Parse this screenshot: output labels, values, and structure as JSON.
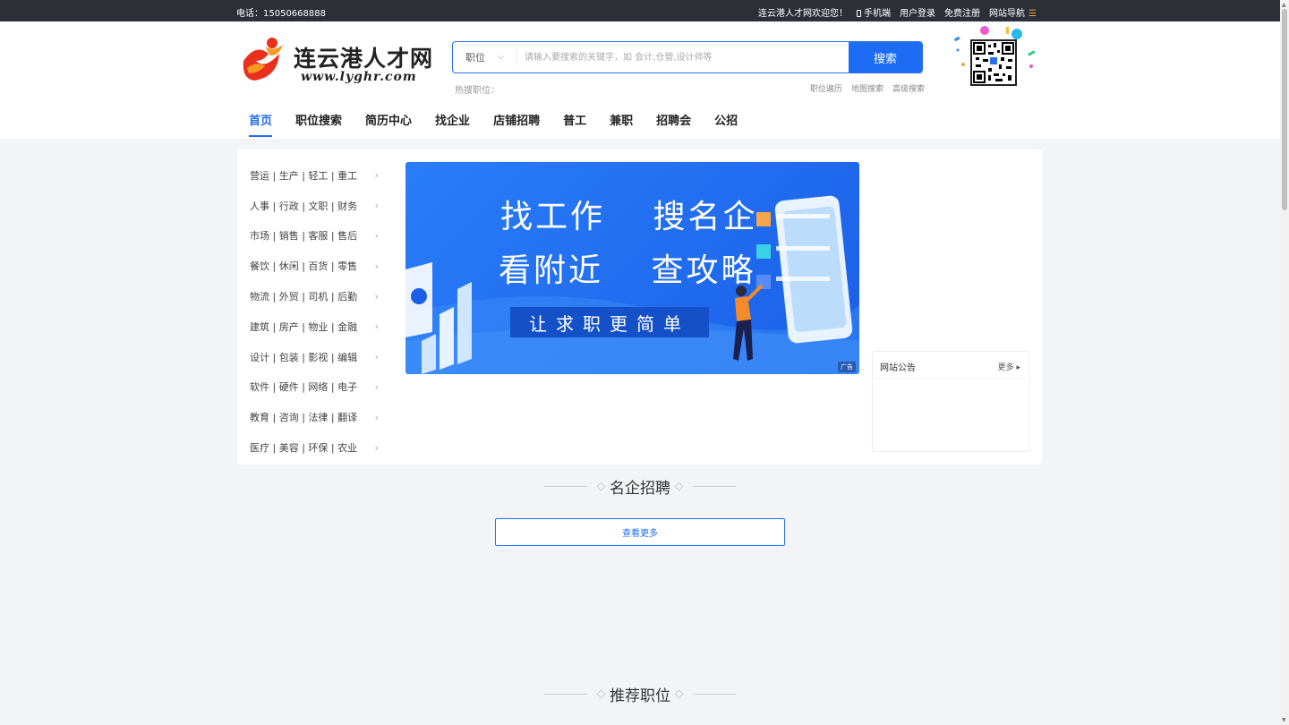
{
  "topbar": {
    "phone": "电话：15050668888",
    "welcome": "连云港人才网欢迎您！",
    "mobile": "手机端",
    "login": "用户登录",
    "register": "免费注册",
    "site_nav": "网站导航"
  },
  "logo": {
    "brand": "连云港人才网",
    "url": "www.lyghr.com"
  },
  "search": {
    "type": "职位",
    "placeholder": "请输入要搜索的关键字，如 会计,仓管,设计师等",
    "button": "搜索",
    "hot_label": "热搜职位：",
    "quick_links": [
      "职位遍历",
      "地图搜索",
      "高级搜索"
    ]
  },
  "nav": {
    "items": [
      "首页",
      "职位搜索",
      "简历中心",
      "找企业",
      "店铺招聘",
      "普工",
      "兼职",
      "招聘会",
      "公招"
    ],
    "active": "首页"
  },
  "categories": [
    "营运 | 生产 | 轻工 | 重工",
    "人事 | 行政 | 文职 | 财务",
    "市场 | 销售 | 客服 | 售后",
    "餐饮 | 休闲 | 百货 | 零售",
    "物流 | 外贸 | 司机 | 后勤",
    "建筑 | 房产 | 物业 | 金融",
    "设计 | 包装 | 影视 | 编辑",
    "软件 | 硬件 | 网络 | 电子",
    "教育 | 咨询 | 法律 | 翻译",
    "医疗 | 美容 | 环保 | 农业"
  ],
  "banner": {
    "line1": "找工作　 搜名企",
    "line2": "看附近　 查攻略",
    "slogan": "让求职更简单",
    "ad_tag": "广告"
  },
  "notice": {
    "title": "网站公告",
    "more": "更多"
  },
  "sections": {
    "famous": "名企招聘",
    "view_more": "查看更多",
    "recommend": "推荐职位"
  },
  "colors": {
    "accent": "#1f6cf4",
    "topbar": "#2c2f36",
    "background": "#f3f4f7"
  }
}
